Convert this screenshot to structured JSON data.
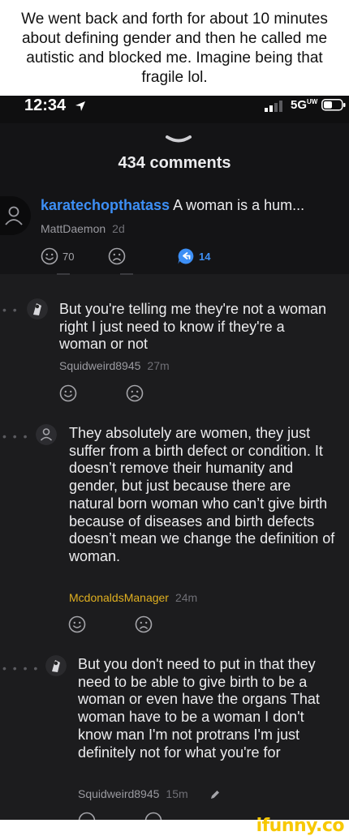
{
  "caption": "We went back and forth for about 10 minutes about defining gender and then he called me autistic and blocked me. Imagine being that fragile lol.",
  "status": {
    "time": "12:34",
    "network": "5G",
    "network_sup": "UW"
  },
  "sheet": {
    "title": "434 comments"
  },
  "main_comment": {
    "username": "karatechopthatass",
    "text": "A woman is a hum...",
    "reply_to": "MattDaemon",
    "age": "2d",
    "likes": "70",
    "replies": "14"
  },
  "replies": [
    {
      "text": "But you're telling me they're not a woman right I just need to know if they're a woman or not",
      "author": "Squidweird8945",
      "age": "27m",
      "author_color": "#9a9aa0"
    },
    {
      "text": "They absolutely are women, they just suffer from a birth defect or condition. It doesn’t remove their humanity and gender, but just because there are natural born woman who can’t give birth because of diseases and birth defects doesn’t mean we change the definition of woman.",
      "author": "McdonaldsManager",
      "age": "24m",
      "author_color": "#e0b020"
    },
    {
      "text": "But you don't need to put in that they need to be able to give birth to be a woman or even have the organs That woman have to be a woman I don't know man I'm not protrans I'm just definitely not for what you're for",
      "author": "Squidweird8945",
      "age": "15m",
      "author_color": "#9a9aa0"
    }
  ],
  "icons": {
    "location": "location-arrow-icon",
    "signal": "signal-bars-icon",
    "battery": "battery-icon",
    "upvote": "smile-icon",
    "downvote": "frown-icon",
    "reply": "reply-bubble-icon",
    "edit": "pencil-icon"
  },
  "colors": {
    "accent": "#3d8ff5",
    "gold": "#e0b020",
    "watermark": "#f7c800"
  },
  "watermark": "ifunny.co"
}
